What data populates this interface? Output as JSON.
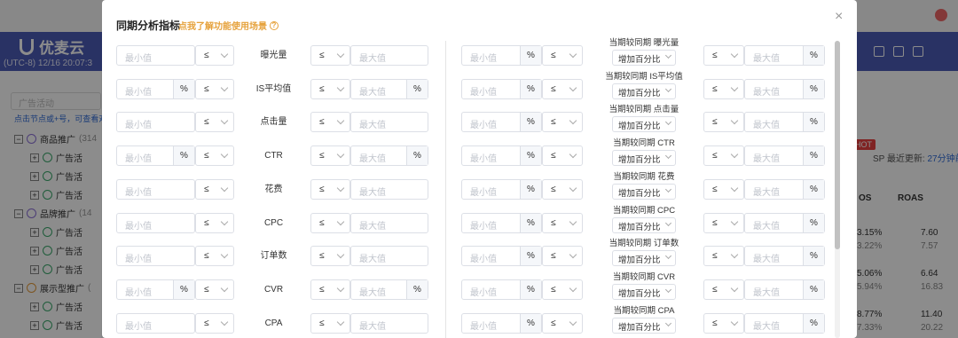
{
  "background": {
    "brand": "优麦云",
    "time": "(UTC-8) 12/16 20:07:3",
    "search_placeholder": "广告活动",
    "hint": "点击节点或+号，可查看对",
    "tree": [
      {
        "label": "商品推广",
        "count": "(314",
        "level": 0,
        "icon": "sp"
      },
      {
        "label": "广告活",
        "level": 1,
        "icon": "ok"
      },
      {
        "label": "广告活",
        "level": 1,
        "icon": "ok"
      },
      {
        "label": "广告活",
        "level": 1,
        "icon": "ok"
      },
      {
        "label": "品牌推广",
        "count": "(14",
        "level": 0,
        "icon": "sb"
      },
      {
        "label": "广告活",
        "level": 1,
        "icon": "ok"
      },
      {
        "label": "广告活",
        "level": 1,
        "icon": "ok"
      },
      {
        "label": "广告活",
        "level": 1,
        "icon": "ok"
      },
      {
        "label": "展示型推广",
        "count": "(",
        "level": 0,
        "icon": "sd"
      },
      {
        "label": "广告活",
        "level": 1,
        "icon": "ok"
      },
      {
        "label": "广告活",
        "level": 1,
        "icon": "ok"
      },
      {
        "label": "广告活",
        "level": 1,
        "icon": "ok"
      }
    ],
    "hot": "HOT",
    "update_prefix": "SP 最近更新: ",
    "update_link": "27分钟前",
    "col_os": "OS",
    "col_roas": "ROAS",
    "values_left": [
      "3.15%",
      "3.22%",
      "5.06%",
      "5.94%",
      "8.77%",
      "7.33%"
    ],
    "values_right": [
      "7.60",
      "7.57",
      "6.64",
      "16.83",
      "11.40",
      "20.22"
    ]
  },
  "modal": {
    "title": "同期分析指标",
    "help": "点我了解功能使用场景",
    "close": "×",
    "min_placeholder": "最小值",
    "max_placeholder": "最大值",
    "operator": "≤",
    "percent": "%",
    "compare_option": "增加百分比",
    "left_rows": [
      {
        "metric": "曝光量",
        "min_percent": false,
        "max_percent": false
      },
      {
        "metric": "IS平均值",
        "min_percent": true,
        "max_percent": true
      },
      {
        "metric": "点击量",
        "min_percent": false,
        "max_percent": false
      },
      {
        "metric": "CTR",
        "min_percent": true,
        "max_percent": true
      },
      {
        "metric": "花费",
        "min_percent": false,
        "max_percent": false
      },
      {
        "metric": "CPC",
        "min_percent": false,
        "max_percent": false
      },
      {
        "metric": "订单数",
        "min_percent": false,
        "max_percent": false
      },
      {
        "metric": "CVR",
        "min_percent": true,
        "max_percent": true
      },
      {
        "metric": "CPA",
        "min_percent": false,
        "max_percent": false
      }
    ],
    "right_rows": [
      {
        "label": "当期较同期 曝光量"
      },
      {
        "label": "当期较同期 IS平均值"
      },
      {
        "label": "当期较同期 点击量"
      },
      {
        "label": "当期较同期 CTR"
      },
      {
        "label": "当期较同期 花费"
      },
      {
        "label": "当期较同期 CPC"
      },
      {
        "label": "当期较同期 订单数"
      },
      {
        "label": "当期较同期 CVR"
      },
      {
        "label": "当期较同期 CPA"
      }
    ]
  }
}
